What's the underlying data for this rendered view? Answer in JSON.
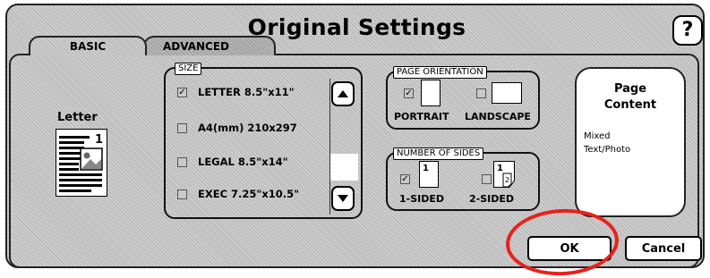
{
  "window": {
    "title": "Original Settings",
    "help_label": "?"
  },
  "tabs": {
    "basic": "BASIC",
    "advanced": "ADVANCED"
  },
  "preview": {
    "label": "Letter"
  },
  "size_group": {
    "caption": "SIZE",
    "options": [
      {
        "label": "LETTER 8.5\"x11\"",
        "checked": true
      },
      {
        "label": "A4(mm) 210x297",
        "checked": false
      },
      {
        "label": "LEGAL 8.5\"x14\"",
        "checked": false
      },
      {
        "label": "EXEC 7.25\"x10.5\"",
        "checked": false
      }
    ]
  },
  "orientation_group": {
    "caption": "PAGE ORIENTATION",
    "portrait": "PORTRAIT",
    "landscape": "LANDSCAPE",
    "selected": "PORTRAIT"
  },
  "sides_group": {
    "caption": "NUMBER OF SIDES",
    "one_sided": "1-SIDED",
    "two_sided": "2-SIDED",
    "selected": "1-SIDED"
  },
  "page_content": {
    "title_line1": "Page",
    "title_line2": "Content",
    "value_line1": "Mixed",
    "value_line2": "Text/Photo"
  },
  "buttons": {
    "ok": "OK",
    "cancel": "Cancel"
  },
  "icons": {
    "help": "help-icon",
    "scroll_up": "arrow-up-icon",
    "scroll_down": "arrow-down-icon",
    "check": "checkmark-icon"
  },
  "colors": {
    "annotation": "#e8211c",
    "background": "#bdbdbd"
  }
}
